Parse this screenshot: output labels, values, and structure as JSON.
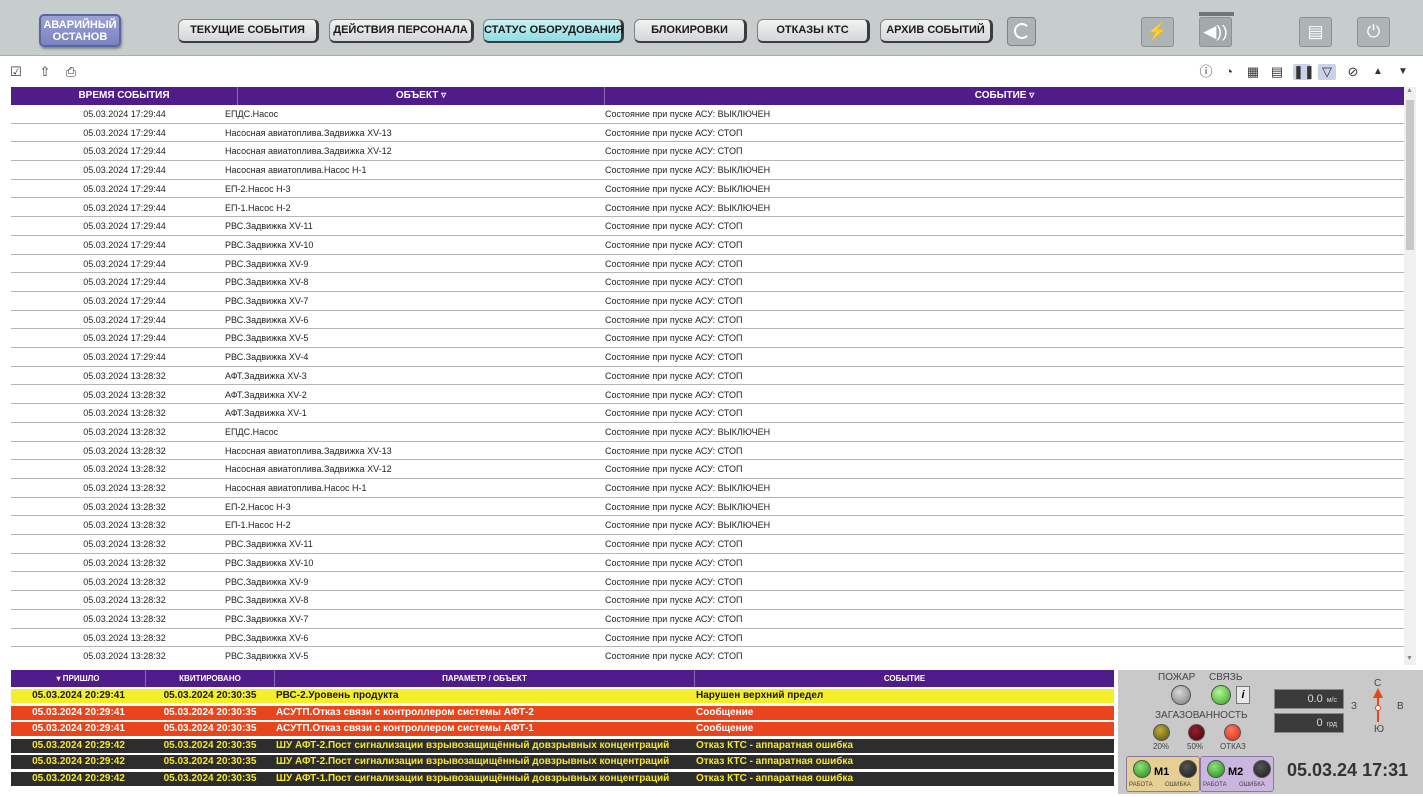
{
  "topbar": {
    "emergency_stop": "АВАРИЙНЫЙ ОСТАНОВ",
    "nav": [
      {
        "label": "ТЕКУЩИЕ СОБЫТИЯ",
        "active": false
      },
      {
        "label": "ДЕЙСТВИЯ ПЕРСОНАЛА",
        "active": false
      },
      {
        "label": "СТАТУС ОБОРУДОВАНИЯ",
        "active": true
      },
      {
        "label": "БЛОКИРОВКИ",
        "active": false
      },
      {
        "label": "ОТКАЗЫ КТС",
        "active": false
      },
      {
        "label": "АРХИВ СОБЫТИЙ",
        "active": false
      }
    ],
    "icons": {
      "refresh": "refresh-icon",
      "lightning": "lightning-icon",
      "sound": "speaker-icon",
      "cards": "cards-icon",
      "power": "power-icon"
    }
  },
  "toolbar": {
    "left_icons": [
      "checklist-icon",
      "export-icon",
      "print-icon"
    ],
    "right_icons": [
      "info-icon",
      "play-icon",
      "calendar-icon",
      "document-icon",
      "pause-icon",
      "filter-icon",
      "reset-filter-icon",
      "sort-up-icon",
      "sort-down-icon"
    ]
  },
  "events": {
    "headers": {
      "time": "ВРЕМЯ СОБЫТИЯ",
      "object": "ОБЪЕКТ ▿",
      "event": "СОБЫТИЕ ▿"
    },
    "rows": [
      {
        "time": "05.03.2024 17:29:44",
        "object": "ЕПДС.Насос",
        "event": "Состояние при пуске АСУ: ВЫКЛЮЧЕН"
      },
      {
        "time": "05.03.2024 17:29:44",
        "object": "Насосная авиатоплива.Задвижка XV-13",
        "event": "Состояние при пуске АСУ: СТОП"
      },
      {
        "time": "05.03.2024 17:29:44",
        "object": "Насосная авиатоплива.Задвижка XV-12",
        "event": "Состояние при пуске АСУ: СТОП"
      },
      {
        "time": "05.03.2024 17:29:44",
        "object": "Насосная авиатоплива.Насос Н-1",
        "event": "Состояние при пуске АСУ: ВЫКЛЮЧЕН"
      },
      {
        "time": "05.03.2024 17:29:44",
        "object": "ЕП-2.Насос Н-3",
        "event": "Состояние при пуске АСУ: ВЫКЛЮЧЕН"
      },
      {
        "time": "05.03.2024 17:29:44",
        "object": "ЕП-1.Насос Н-2",
        "event": "Состояние при пуске АСУ: ВЫКЛЮЧЕН"
      },
      {
        "time": "05.03.2024 17:29:44",
        "object": "РВС.Задвижка XV-11",
        "event": "Состояние при пуске АСУ: СТОП"
      },
      {
        "time": "05.03.2024 17:29:44",
        "object": "РВС.Задвижка XV-10",
        "event": "Состояние при пуске АСУ: СТОП"
      },
      {
        "time": "05.03.2024 17:29:44",
        "object": "РВС.Задвижка XV-9",
        "event": "Состояние при пуске АСУ: СТОП"
      },
      {
        "time": "05.03.2024 17:29:44",
        "object": "РВС.Задвижка XV-8",
        "event": "Состояние при пуске АСУ: СТОП"
      },
      {
        "time": "05.03.2024 17:29:44",
        "object": "РВС.Задвижка XV-7",
        "event": "Состояние при пуске АСУ: СТОП"
      },
      {
        "time": "05.03.2024 17:29:44",
        "object": "РВС.Задвижка XV-6",
        "event": "Состояние при пуске АСУ: СТОП"
      },
      {
        "time": "05.03.2024 17:29:44",
        "object": "РВС.Задвижка XV-5",
        "event": "Состояние при пуске АСУ: СТОП"
      },
      {
        "time": "05.03.2024 17:29:44",
        "object": "РВС.Задвижка XV-4",
        "event": "Состояние при пуске АСУ: СТОП"
      },
      {
        "time": "05.03.2024 13:28:32",
        "object": "АФТ.Задвижка XV-3",
        "event": "Состояние при пуске АСУ: СТОП"
      },
      {
        "time": "05.03.2024 13:28:32",
        "object": "АФТ.Задвижка XV-2",
        "event": "Состояние при пуске АСУ: СТОП"
      },
      {
        "time": "05.03.2024 13:28:32",
        "object": "АФТ.Задвижка XV-1",
        "event": "Состояние при пуске АСУ: СТОП"
      },
      {
        "time": "05.03.2024 13:28:32",
        "object": "ЕПДС.Насос",
        "event": "Состояние при пуске АСУ: ВЫКЛЮЧЕН"
      },
      {
        "time": "05.03.2024 13:28:32",
        "object": "Насосная авиатоплива.Задвижка XV-13",
        "event": "Состояние при пуске АСУ: СТОП"
      },
      {
        "time": "05.03.2024 13:28:32",
        "object": "Насосная авиатоплива.Задвижка XV-12",
        "event": "Состояние при пуске АСУ: СТОП"
      },
      {
        "time": "05.03.2024 13:28:32",
        "object": "Насосная авиатоплива.Насос Н-1",
        "event": "Состояние при пуске АСУ: ВЫКЛЮЧЕН"
      },
      {
        "time": "05.03.2024 13:28:32",
        "object": "ЕП-2.Насос Н-3",
        "event": "Состояние при пуске АСУ: ВЫКЛЮЧЕН"
      },
      {
        "time": "05.03.2024 13:28:32",
        "object": "ЕП-1.Насос Н-2",
        "event": "Состояние при пуске АСУ: ВЫКЛЮЧЕН"
      },
      {
        "time": "05.03.2024 13:28:32",
        "object": "РВС.Задвижка XV-11",
        "event": "Состояние при пуске АСУ: СТОП"
      },
      {
        "time": "05.03.2024 13:28:32",
        "object": "РВС.Задвижка XV-10",
        "event": "Состояние при пуске АСУ: СТОП"
      },
      {
        "time": "05.03.2024 13:28:32",
        "object": "РВС.Задвижка XV-9",
        "event": "Состояние при пуске АСУ: СТОП"
      },
      {
        "time": "05.03.2024 13:28:32",
        "object": "РВС.Задвижка XV-8",
        "event": "Состояние при пуске АСУ: СТОП"
      },
      {
        "time": "05.03.2024 13:28:32",
        "object": "РВС.Задвижка XV-7",
        "event": "Состояние при пуске АСУ: СТОП"
      },
      {
        "time": "05.03.2024 13:28:32",
        "object": "РВС.Задвижка XV-6",
        "event": "Состояние при пуске АСУ: СТОП"
      },
      {
        "time": "05.03.2024 13:28:32",
        "object": "РВС.Задвижка XV-5",
        "event": "Состояние при пуске АСУ: СТОП"
      }
    ]
  },
  "alarms": {
    "headers": {
      "arrived": "▾ ПРИШЛО",
      "acked": "КВИТИРОВАНО",
      "param": "ПАРАМЕТР / ОБЪЕКТ",
      "event": "СОБЫТИЕ"
    },
    "rows": [
      {
        "arrived": "05.03.2024 20:29:41",
        "acked": "05.03.2024 20:30:35",
        "param": "РВС-2.Уровень продукта",
        "event": "Нарушен верхний предел",
        "bg": "#f5ee2c",
        "fg": "#1a1a1a"
      },
      {
        "arrived": "05.03.2024 20:29:41",
        "acked": "05.03.2024 20:30:35",
        "param": "АСУТП.Отказ связи с контроллером системы АФТ-2",
        "event": "Сообщение",
        "bg": "#e8451c",
        "fg": "#ffffff"
      },
      {
        "arrived": "05.03.2024 20:29:41",
        "acked": "05.03.2024 20:30:35",
        "param": "АСУТП.Отказ связи с контроллером системы АФТ-1",
        "event": "Сообщение",
        "bg": "#e8451c",
        "fg": "#ffffff"
      },
      {
        "arrived": "05.03.2024 20:29:42",
        "acked": "05.03.2024 20:30:35",
        "param": "ШУ АФТ-2.Пост сигнализации взрывозащищённый довзрывных концентраций",
        "event": "Отказ КТС - аппаратная ошибка",
        "bg": "#2d2d2d",
        "fg": "#f5e62c"
      },
      {
        "arrived": "05.03.2024 20:29:42",
        "acked": "05.03.2024 20:30:35",
        "param": "ШУ АФТ-2.Пост сигнализации взрывозащищённый довзрывных концентраций",
        "event": "Отказ КТС - аппаратная ошибка",
        "bg": "#2d2d2d",
        "fg": "#f5e62c"
      },
      {
        "arrived": "05.03.2024 20:29:42",
        "acked": "05.03.2024 20:30:35",
        "param": "ШУ АФТ-1.Пост сигнализации взрывозащищённый довзрывных концентраций",
        "event": "Отказ КТС - аппаратная ошибка",
        "bg": "#2d2d2d",
        "fg": "#f5e62c"
      }
    ]
  },
  "panel": {
    "fire": "ПОЖАР",
    "link": "СВЯЗЬ",
    "gas": "ЗАГАЗОВАННОСТЬ",
    "gas_levels": [
      "20%",
      "50%",
      "ОТКАЗ"
    ],
    "wind_speed": "0.0",
    "wind_speed_unit": "м/с",
    "wind_dir": "0",
    "wind_dir_unit": "грд",
    "compass": {
      "n": "С",
      "s": "Ю",
      "w": "З",
      "e": "В"
    },
    "info_button": "i",
    "modules": [
      {
        "name": "М1",
        "work": "РАБОТА",
        "error": "ОШИБКА"
      },
      {
        "name": "М2",
        "work": "РАБОТА",
        "error": "ОШИБКА"
      }
    ],
    "clock": "05.03.24 17:31"
  }
}
